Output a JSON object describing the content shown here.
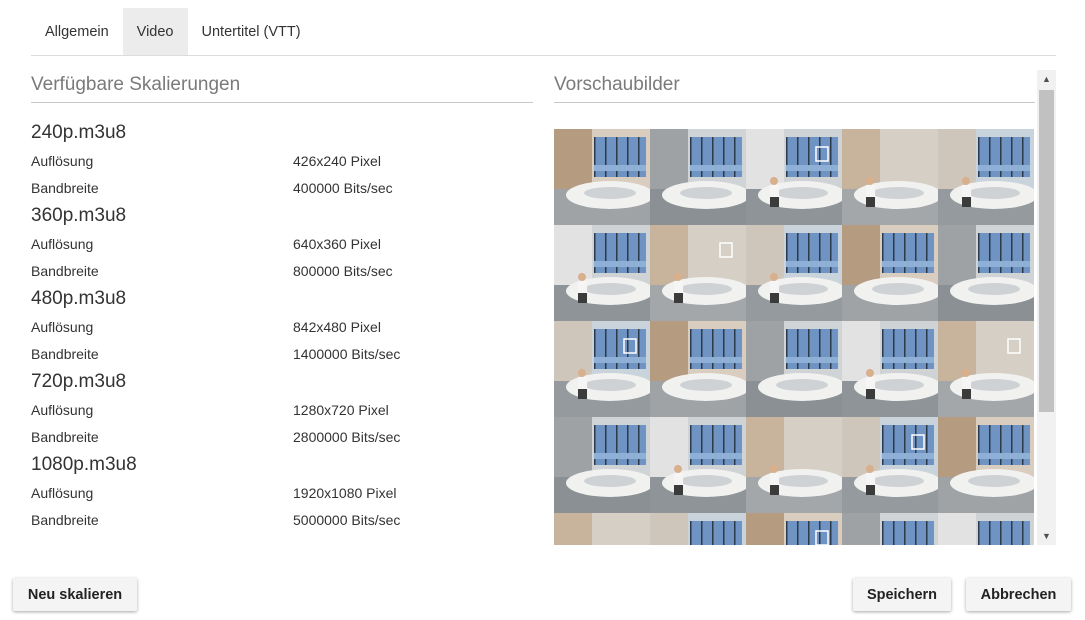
{
  "tabs": [
    {
      "label": "Allgemein",
      "active": false
    },
    {
      "label": "Video",
      "active": true
    },
    {
      "label": "Untertitel (VTT)",
      "active": false
    }
  ],
  "scalings_section": {
    "title": "Verfügbare Skalierungen",
    "items": [
      {
        "name": "240p.m3u8",
        "resolution_label": "Auflösung",
        "resolution": "426x240 Pixel",
        "bandwidth_label": "Bandbreite",
        "bandwidth": "400000 Bits/sec"
      },
      {
        "name": "360p.m3u8",
        "resolution_label": "Auflösung",
        "resolution": "640x360 Pixel",
        "bandwidth_label": "Bandbreite",
        "bandwidth": "800000 Bits/sec"
      },
      {
        "name": "480p.m3u8",
        "resolution_label": "Auflösung",
        "resolution": "842x480 Pixel",
        "bandwidth_label": "Bandbreite",
        "bandwidth": "1400000 Bits/sec"
      },
      {
        "name": "720p.m3u8",
        "resolution_label": "Auflösung",
        "resolution": "1280x720 Pixel",
        "bandwidth_label": "Bandbreite",
        "bandwidth": "2800000 Bits/sec"
      },
      {
        "name": "1080p.m3u8",
        "resolution_label": "Auflösung",
        "resolution": "1920x1080 Pixel",
        "bandwidth_label": "Bandbreite",
        "bandwidth": "5000000 Bits/sec"
      }
    ]
  },
  "thumbnails_section": {
    "title": "Vorschaubilder",
    "thumbnail_count_visible": 25
  },
  "buttons": {
    "rescale": "Neu skalieren",
    "save": "Speichern",
    "cancel": "Abbrechen"
  },
  "icons": {
    "scroll_up": "scroll-up-arrow-icon",
    "scroll_down": "scroll-down-arrow-icon"
  }
}
